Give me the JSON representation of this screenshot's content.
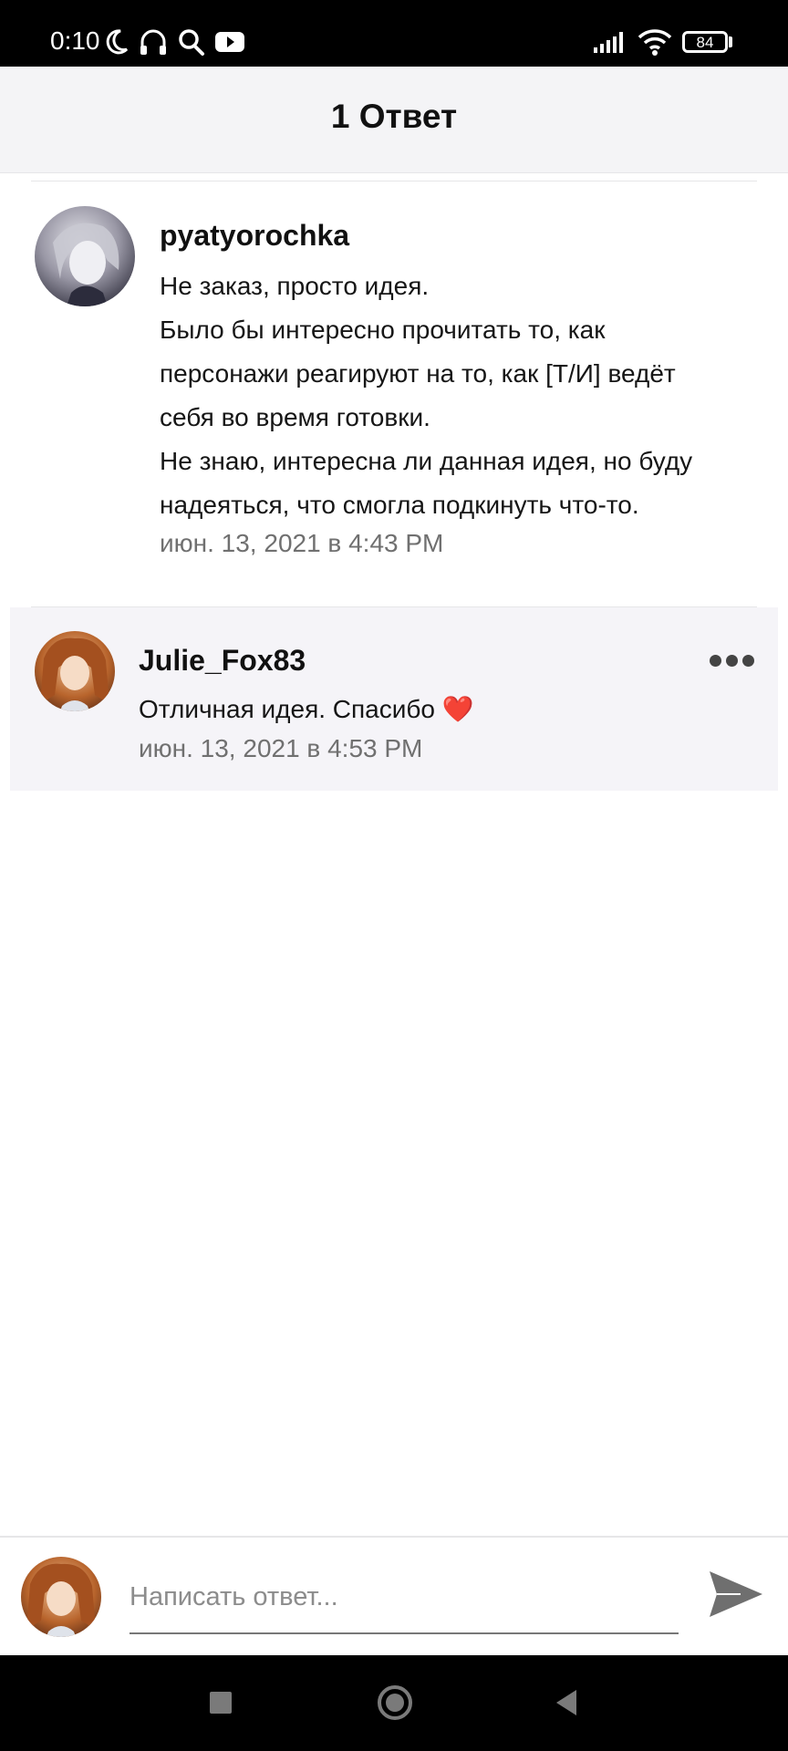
{
  "status_bar": {
    "time": "0:10",
    "battery": "84",
    "icons": [
      "moon-icon",
      "headphones-icon",
      "search-icon",
      "youtube-icon",
      "signal-icon",
      "wifi-icon",
      "battery-icon"
    ]
  },
  "header": {
    "title": "1 Ответ"
  },
  "comment": {
    "author": "pyatyorochka",
    "lines": [
      "Не заказ, просто идея.",
      "Было бы интересно прочитать то, как",
      "персонажи реагируют на то, как [Т/И] ведёт",
      "себя во время готовки.",
      "Не знаю, интересна ли данная идея, но буду",
      "надеяться, что смогла подкинуть что-то."
    ],
    "timestamp": "июн. 13, 2021 в 4:43 PM"
  },
  "reply": {
    "author": "Julie_Fox83",
    "text": "Отличная идея. Спасибо ❤️",
    "timestamp": "июн. 13, 2021 в 4:53 PM"
  },
  "reply_box": {
    "placeholder": "Написать ответ..."
  },
  "colors": {
    "header_bg": "#f4f4f6",
    "reply_card_bg": "#f5f4f8",
    "timestamp": "#707070",
    "heart": "#e0332f"
  }
}
